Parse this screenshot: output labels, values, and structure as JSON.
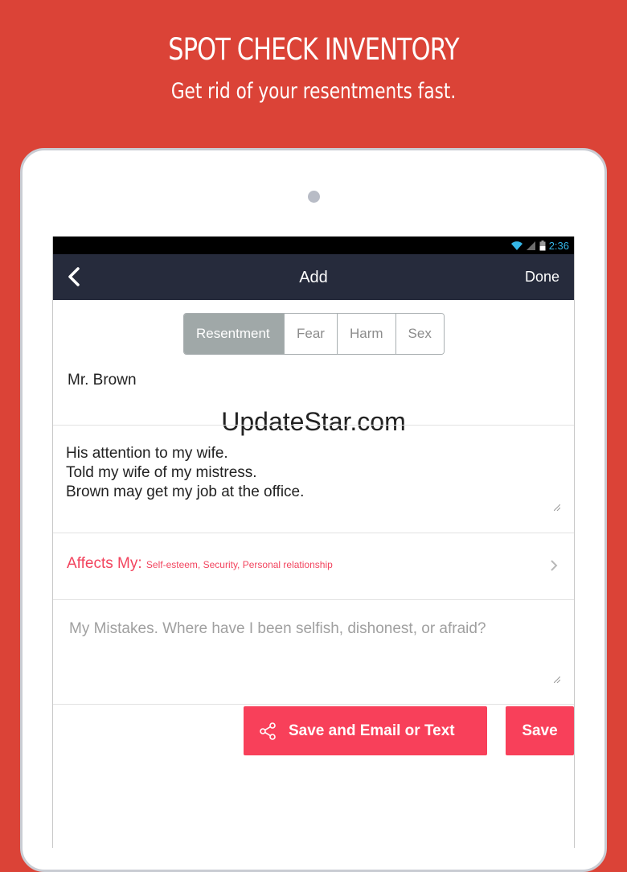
{
  "promo": {
    "title": "SPOT CHECK INVENTORY",
    "subtitle": "Get rid of your resentments fast."
  },
  "status_bar": {
    "time": "2:36"
  },
  "app_bar": {
    "title": "Add",
    "done_label": "Done"
  },
  "segments": [
    "Resentment",
    "Fear",
    "Harm",
    "Sex"
  ],
  "selected_segment": "Resentment",
  "form": {
    "name": "Mr. Brown",
    "description_lines": [
      "His attention to my wife.",
      "Told my wife of my mistress.",
      "Brown may get my job at the office."
    ],
    "affects_label": "Affects My:",
    "affects_values": "Self-esteem, Security, Personal relationship",
    "mistakes_placeholder": "My Mistakes.  Where have I been selfish, dishonest, or afraid?"
  },
  "buttons": {
    "email_label": "Save and Email or Text",
    "save_label": "Save"
  },
  "watermark": "UpdateStar.com",
  "colors": {
    "background": "#db4337",
    "app_bar": "#262b3c",
    "accent": "#f8405a",
    "selected_segment": "#a0a8a8"
  }
}
